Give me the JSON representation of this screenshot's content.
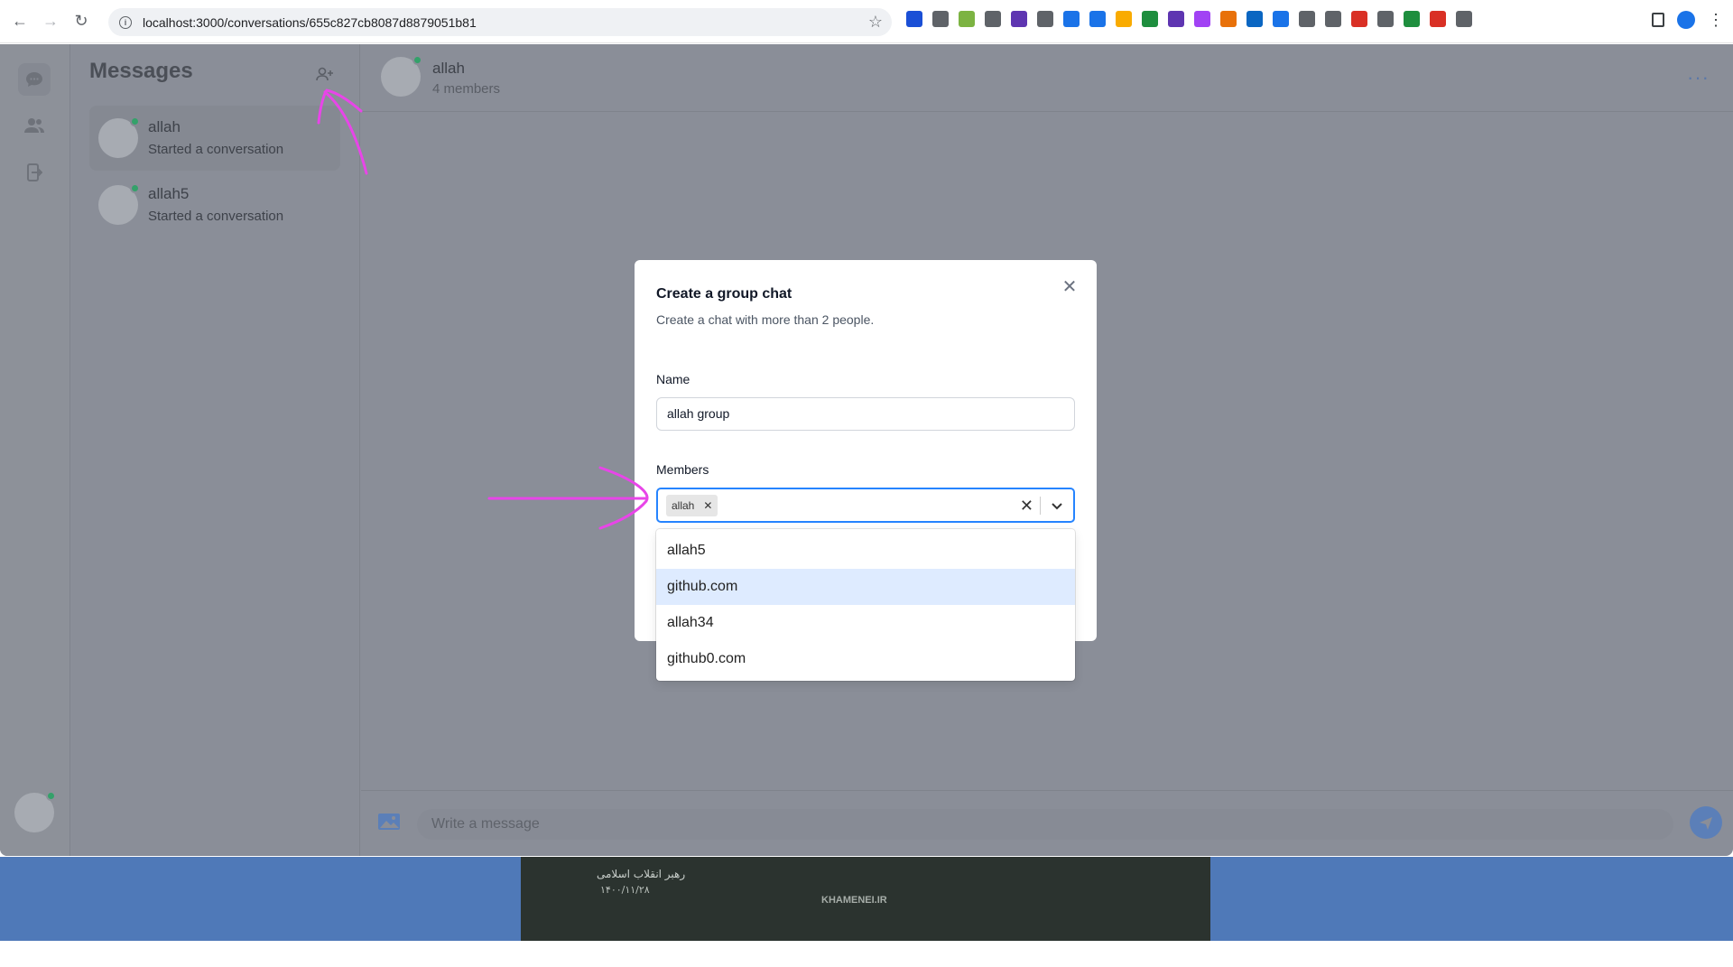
{
  "browser": {
    "url": "localhost:3000/conversations/655c827cb8087d8879051b81",
    "extension_colors": [
      "#1a4fd6",
      "#5f6368",
      "#7cb342",
      "#5f6368",
      "#5e35b1",
      "#5f6368",
      "#1a73e8",
      "#1a73e8",
      "#f9ab00",
      "#1e8e3e",
      "#5e35b1",
      "#a142f4",
      "#e8710a",
      "#0a66c2",
      "#1a73e8",
      "#5f6368",
      "#5f6368",
      "#d93025",
      "#5f6368",
      "#1e8e3e",
      "#d93025",
      "#5f6368"
    ]
  },
  "sidebar": {
    "title": "Messages",
    "conversations": [
      {
        "name": "allah",
        "preview": "Started a conversation",
        "active": true
      },
      {
        "name": "allah5",
        "preview": "Started a conversation",
        "active": false
      }
    ]
  },
  "chat": {
    "name": "allah",
    "members": "4 members",
    "more_label": "···"
  },
  "composer": {
    "placeholder": "Write a message"
  },
  "modal": {
    "title": "Create a group chat",
    "description": "Create a chat with more than 2 people.",
    "name_label": "Name",
    "name_value": "allah group",
    "members_label": "Members",
    "selected_members": [
      "allah"
    ],
    "options": [
      "allah5",
      "github.com",
      "allah34",
      "github0.com"
    ],
    "focused_option": "github.com"
  },
  "banner": {
    "line1": "رهبر انقلاب اسلامی",
    "line2": "۱۴۰۰/۱۱/۲۸",
    "logo": "KHAMENEI.IR"
  },
  "colors": {
    "annotation": "#e845e8",
    "select_focus": "#2684ff",
    "online": "#34a16a"
  }
}
